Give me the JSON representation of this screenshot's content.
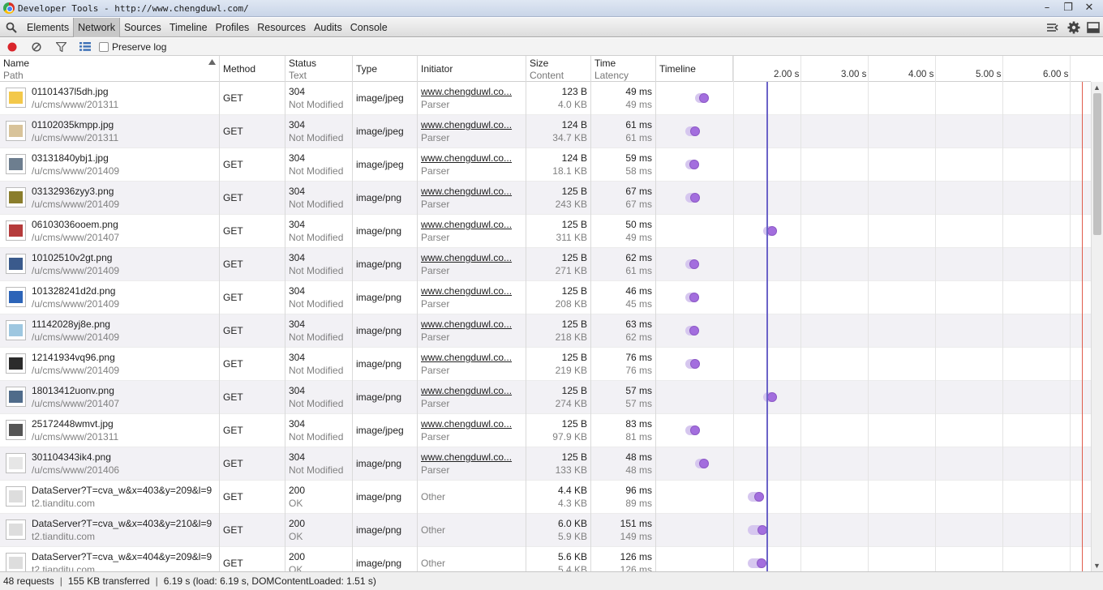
{
  "window": {
    "title": "Developer Tools - http://www.chengduwl.com/"
  },
  "panels": [
    "Elements",
    "Network",
    "Sources",
    "Timeline",
    "Profiles",
    "Resources",
    "Audits",
    "Console"
  ],
  "active_panel": "Network",
  "toolbar": {
    "preserve_log_label": "Preserve log",
    "preserve_log_checked": false
  },
  "columns": {
    "name": {
      "label": "Name",
      "sub": "Path"
    },
    "method": {
      "label": "Method"
    },
    "status": {
      "label": "Status",
      "sub": "Text"
    },
    "type": {
      "label": "Type"
    },
    "initiator": {
      "label": "Initiator"
    },
    "size": {
      "label": "Size",
      "sub": "Content"
    },
    "time": {
      "label": "Time",
      "sub": "Latency"
    },
    "timeline": {
      "label": "Timeline"
    }
  },
  "timeline_ticks": [
    "2.00 s",
    "3.00 s",
    "4.00 s",
    "5.00 s",
    "6.00 s"
  ],
  "rows": [
    {
      "name": "01101437l5dh.jpg",
      "path": "/u/cms/www/201311",
      "method": "GET",
      "status": "304",
      "status_text": "Not Modified",
      "type": "image/jpeg",
      "initiator": "www.chengduwl.co...",
      "initiator_sub": "Parser",
      "size": "123 B",
      "content": "4.0 KB",
      "time": "49 ms",
      "latency": "49 ms",
      "bar_start": 0.17,
      "bar_end": 0.23,
      "thumb_color": "#f3c84a"
    },
    {
      "name": "01102035kmpp.jpg",
      "path": "/u/cms/www/201311",
      "method": "GET",
      "status": "304",
      "status_text": "Not Modified",
      "type": "image/jpeg",
      "initiator": "www.chengduwl.co...",
      "initiator_sub": "Parser",
      "size": "124 B",
      "content": "34.7 KB",
      "time": "61 ms",
      "latency": "61 ms",
      "bar_start": 0.03,
      "bar_end": 0.1,
      "thumb_color": "#d8c39a"
    },
    {
      "name": "03131840ybj1.jpg",
      "path": "/u/cms/www/201409",
      "method": "GET",
      "status": "304",
      "status_text": "Not Modified",
      "type": "image/jpeg",
      "initiator": "www.chengduwl.co...",
      "initiator_sub": "Parser",
      "size": "124 B",
      "content": "18.1 KB",
      "time": "59 ms",
      "latency": "58 ms",
      "bar_start": 0.03,
      "bar_end": 0.09,
      "thumb_color": "#6d7e8f"
    },
    {
      "name": "03132936zyy3.png",
      "path": "/u/cms/www/201409",
      "method": "GET",
      "status": "304",
      "status_text": "Not Modified",
      "type": "image/png",
      "initiator": "www.chengduwl.co...",
      "initiator_sub": "Parser",
      "size": "125 B",
      "content": "243 KB",
      "time": "67 ms",
      "latency": "67 ms",
      "bar_start": 0.03,
      "bar_end": 0.1,
      "thumb_color": "#8a7d2c"
    },
    {
      "name": "06103036ooem.png",
      "path": "/u/cms/www/201407",
      "method": "GET",
      "status": "304",
      "status_text": "Not Modified",
      "type": "image/png",
      "initiator": "www.chengduwl.co...",
      "initiator_sub": "Parser",
      "size": "125 B",
      "content": "311 KB",
      "time": "50 ms",
      "latency": "49 ms",
      "bar_start": 1.18,
      "bar_end": 1.24,
      "thumb_color": "#b53b3b"
    },
    {
      "name": "10102510v2gt.png",
      "path": "/u/cms/www/201409",
      "method": "GET",
      "status": "304",
      "status_text": "Not Modified",
      "type": "image/png",
      "initiator": "www.chengduwl.co...",
      "initiator_sub": "Parser",
      "size": "125 B",
      "content": "271 KB",
      "time": "62 ms",
      "latency": "61 ms",
      "bar_start": 0.02,
      "bar_end": 0.09,
      "thumb_color": "#3a5a8c"
    },
    {
      "name": "101328241d2d.png",
      "path": "/u/cms/www/201409",
      "method": "GET",
      "status": "304",
      "status_text": "Not Modified",
      "type": "image/png",
      "initiator": "www.chengduwl.co...",
      "initiator_sub": "Parser",
      "size": "125 B",
      "content": "208 KB",
      "time": "46 ms",
      "latency": "45 ms",
      "bar_start": 0.03,
      "bar_end": 0.09,
      "thumb_color": "#2c64b8"
    },
    {
      "name": "11142028yj8e.png",
      "path": "/u/cms/www/201409",
      "method": "GET",
      "status": "304",
      "status_text": "Not Modified",
      "type": "image/png",
      "initiator": "www.chengduwl.co...",
      "initiator_sub": "Parser",
      "size": "125 B",
      "content": "218 KB",
      "time": "63 ms",
      "latency": "62 ms",
      "bar_start": 0.02,
      "bar_end": 0.09,
      "thumb_color": "#9ec7e0"
    },
    {
      "name": "12141934vq96.png",
      "path": "/u/cms/www/201409",
      "method": "GET",
      "status": "304",
      "status_text": "Not Modified",
      "type": "image/png",
      "initiator": "www.chengduwl.co...",
      "initiator_sub": "Parser",
      "size": "125 B",
      "content": "219 KB",
      "time": "76 ms",
      "latency": "76 ms",
      "bar_start": 0.02,
      "bar_end": 0.1,
      "thumb_color": "#2b2b2b"
    },
    {
      "name": "18013412uonv.png",
      "path": "/u/cms/www/201407",
      "method": "GET",
      "status": "304",
      "status_text": "Not Modified",
      "type": "image/png",
      "initiator": "www.chengduwl.co...",
      "initiator_sub": "Parser",
      "size": "125 B",
      "content": "274 KB",
      "time": "57 ms",
      "latency": "57 ms",
      "bar_start": 1.18,
      "bar_end": 1.24,
      "thumb_color": "#4f6b8a"
    },
    {
      "name": "25172448wmvt.jpg",
      "path": "/u/cms/www/201311",
      "method": "GET",
      "status": "304",
      "status_text": "Not Modified",
      "type": "image/jpeg",
      "initiator": "www.chengduwl.co...",
      "initiator_sub": "Parser",
      "size": "125 B",
      "content": "97.9 KB",
      "time": "83 ms",
      "latency": "81 ms",
      "bar_start": 0.02,
      "bar_end": 0.1,
      "thumb_color": "#555555"
    },
    {
      "name": "301104343ik4.png",
      "path": "/u/cms/www/201406",
      "method": "GET",
      "status": "304",
      "status_text": "Not Modified",
      "type": "image/png",
      "initiator": "www.chengduwl.co...",
      "initiator_sub": "Parser",
      "size": "125 B",
      "content": "133 KB",
      "time": "48 ms",
      "latency": "48 ms",
      "bar_start": 0.17,
      "bar_end": 0.23,
      "thumb_color": "#e6e6e6"
    },
    {
      "name": "DataServer?T=cva_w&x=403&y=209&l=9",
      "path": "t2.tianditu.com",
      "method": "GET",
      "status": "200",
      "status_text": "OK",
      "type": "image/png",
      "initiator": "Other",
      "initiator_sub": "",
      "size": "4.4 KB",
      "content": "4.3 KB",
      "time": "96 ms",
      "latency": "89 ms",
      "bar_start": 0.95,
      "bar_end": 1.05,
      "thumb_color": "#dddddd"
    },
    {
      "name": "DataServer?T=cva_w&x=403&y=210&l=9",
      "path": "t2.tianditu.com",
      "method": "GET",
      "status": "200",
      "status_text": "OK",
      "type": "image/png",
      "initiator": "Other",
      "initiator_sub": "",
      "size": "6.0 KB",
      "content": "5.9 KB",
      "time": "151 ms",
      "latency": "149 ms",
      "bar_start": 0.95,
      "bar_end": 1.1,
      "thumb_color": "#dddddd"
    },
    {
      "name": "DataServer?T=cva_w&x=404&y=209&l=9",
      "path": "t2.tianditu.com",
      "method": "GET",
      "status": "200",
      "status_text": "OK",
      "type": "image/png",
      "initiator": "Other",
      "initiator_sub": "",
      "size": "5.6 KB",
      "content": "5.4 KB",
      "time": "126 ms",
      "latency": "126 ms",
      "bar_start": 0.95,
      "bar_end": 1.08,
      "thumb_color": "#dddddd"
    }
  ],
  "status_bar": {
    "requests": "48 requests",
    "transferred": "155 KB transferred",
    "timing": "6.19 s (load: 6.19 s, DOMContentLoaded: 1.51 s)"
  },
  "colors": {
    "bar_light": "#d6c7ef",
    "bar_dark": "#a36ede",
    "load_line": "#6b63c8",
    "dom_line": "#e05d4d"
  }
}
